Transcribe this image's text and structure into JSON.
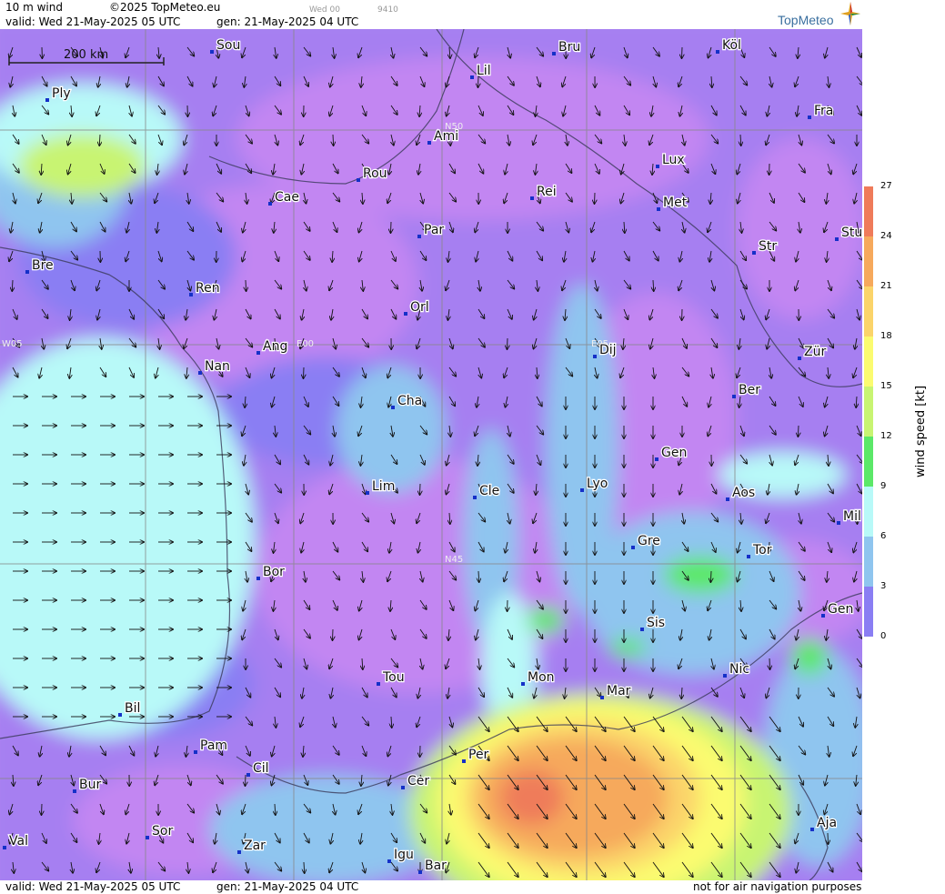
{
  "header": {
    "product": "10 m wind",
    "copyright": "©2025 TopMeteo.eu",
    "run_small": "Wed 00",
    "code_small": "9410",
    "valid_line": "valid:  Wed  21-May-2025  05 UTC",
    "gen_line": "gen: 21-May-2025 04 UTC",
    "logo": "TopMeteo"
  },
  "scale_bar": {
    "label": "200 km"
  },
  "grid_labels": [
    "N50",
    "N45",
    "W05",
    "E00",
    "E05"
  ],
  "cities": [
    "Sou",
    "Bru",
    "Köl",
    "Ply",
    "Lil",
    "Fra",
    "Ami",
    "Lux",
    "Rou",
    "Cae",
    "Rei",
    "Met",
    "Par",
    "Stu",
    "Str",
    "Bre",
    "Ren",
    "Orl",
    "Ang",
    "Dij",
    "Zür",
    "Nan",
    "Ber",
    "Cha",
    "Gen",
    "Lim",
    "Cle",
    "Lyo",
    "Aos",
    "Mil",
    "Gre",
    "Tor",
    "Bor",
    "Sis",
    "Gen",
    "Nic",
    "Tou",
    "Mon",
    "Mar",
    "Bil",
    "Pam",
    "Per",
    "Cil",
    "Bur",
    "Cer",
    "Sor",
    "Aja",
    "Val",
    "Zar",
    "Igu",
    "Bar"
  ],
  "legend": {
    "title": "wind speed [kt]",
    "ticks": [
      "27",
      "24",
      "21",
      "18",
      "15",
      "12",
      "9",
      "6",
      "3",
      "0"
    ],
    "colors": [
      "#ef7b5a",
      "#f6a95c",
      "#fbd46a",
      "#fbfb70",
      "#c8f472",
      "#5be868",
      "#b8f9f8",
      "#8fc5ef",
      "#8a7ef3",
      "#c286f2"
    ]
  },
  "footer": {
    "valid_line": "valid:  Wed  21-May-2025  05 UTC",
    "gen_line": "gen: 21-May-2025 04 UTC",
    "disclaimer": "not for air navigation purposes"
  }
}
